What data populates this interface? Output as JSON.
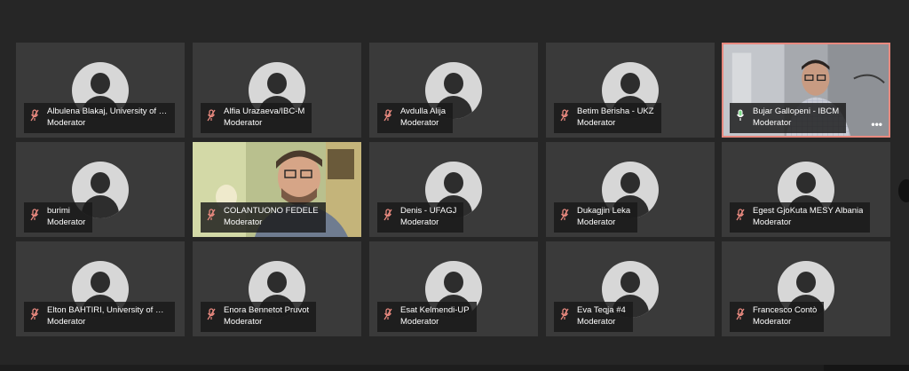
{
  "colors": {
    "background": "#262626",
    "tile": "#3a3a3a",
    "active_border": "#e8897f",
    "muted_mic": "#e8897f",
    "active_mic": "#7ddc8a"
  },
  "participants": [
    {
      "name": "Albulena Blakaj, University of Pri...",
      "role": "Moderator",
      "mic": "muted-mic-icon"
    },
    {
      "name": "Alfia Urazaeva/IBC-M",
      "role": "Moderator",
      "mic": "muted-mic-icon"
    },
    {
      "name": "Avdulla Alija",
      "role": "Moderator",
      "mic": "muted-mic-icon"
    },
    {
      "name": "Betim Berisha - UKZ",
      "role": "Moderator",
      "mic": "muted-mic-icon"
    },
    {
      "name": "Bujar Gallopeni - IBCM",
      "role": "Moderator",
      "mic": "mic-icon",
      "more": "•••"
    },
    {
      "name": "burimi",
      "role": "Moderator",
      "mic": "muted-mic-icon"
    },
    {
      "name": "COLANTUONO FEDELE",
      "role": "Moderator",
      "mic": "muted-mic-icon"
    },
    {
      "name": "Denis - UFAGJ",
      "role": "Moderator",
      "mic": "muted-mic-icon"
    },
    {
      "name": "Dukagjin Leka",
      "role": "Moderator",
      "mic": "muted-mic-icon"
    },
    {
      "name": "Egest GjoKuta MESY Albania",
      "role": "Moderator",
      "mic": "muted-mic-icon"
    },
    {
      "name": "Elton BAHTIRI, University of Prish...",
      "role": "Moderator",
      "mic": "muted-mic-icon"
    },
    {
      "name": "Enora Bennetot Pruvot",
      "role": "Moderator",
      "mic": "muted-mic-icon"
    },
    {
      "name": "Esat Kelmendi-UP",
      "role": "Moderator",
      "mic": "muted-mic-icon"
    },
    {
      "name": "Eva Teqja #4",
      "role": "Moderator",
      "mic": "muted-mic-icon"
    },
    {
      "name": "Francesco Contò",
      "role": "Moderator",
      "mic": "muted-mic-icon"
    }
  ]
}
